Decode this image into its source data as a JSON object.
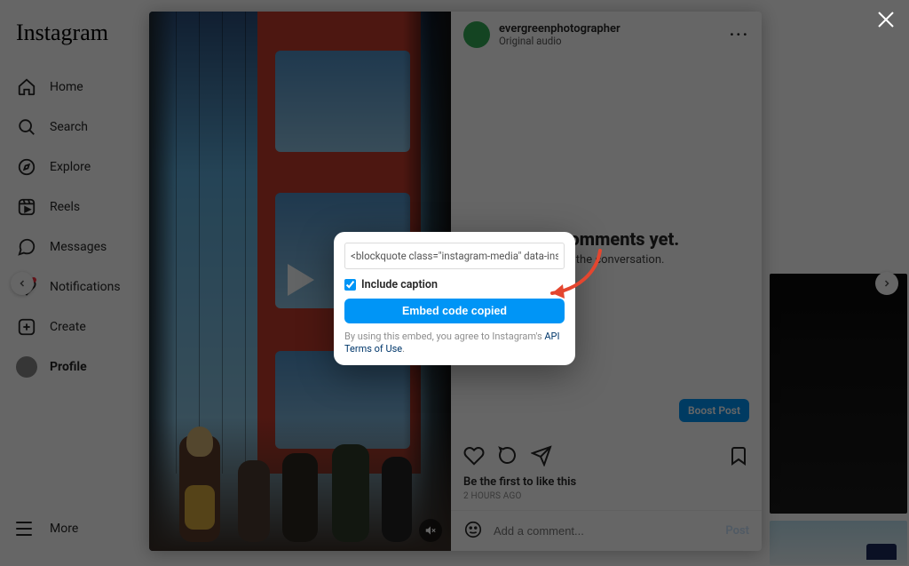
{
  "brand": "Instagram",
  "sidebar": {
    "items": [
      {
        "label": "Home",
        "icon": "home-icon"
      },
      {
        "label": "Search",
        "icon": "search-icon"
      },
      {
        "label": "Explore",
        "icon": "compass-icon"
      },
      {
        "label": "Reels",
        "icon": "reels-icon"
      },
      {
        "label": "Messages",
        "icon": "messenger-icon"
      },
      {
        "label": "Notifications",
        "icon": "heart-icon"
      },
      {
        "label": "Create",
        "icon": "plus-icon"
      },
      {
        "label": "Profile",
        "icon": "avatar-icon",
        "bold": true
      }
    ],
    "more_label": "More"
  },
  "post": {
    "username": "evergreenphotographer",
    "audio_label": "Original audio",
    "comments_title": "No comments yet.",
    "comments_sub": "Start the conversation.",
    "boost_label": "Boost Post",
    "like_prompt": "Be the first to like this",
    "time_label": "2 HOURS AGO",
    "add_comment_placeholder": "Add a comment...",
    "post_button": "Post"
  },
  "embed": {
    "code_value": "<blockquote class=\"instagram-media\" data-instgrm-cap",
    "include_caption_label": "Include caption",
    "include_caption_checked": true,
    "copy_button_label": "Embed code copied",
    "terms_prefix": "By using this embed, you agree to Instagram's ",
    "terms_link_label": "API Terms of Use",
    "terms_suffix": "."
  },
  "colors": {
    "primary": "#0095f6",
    "annotation": "#e4462f"
  }
}
